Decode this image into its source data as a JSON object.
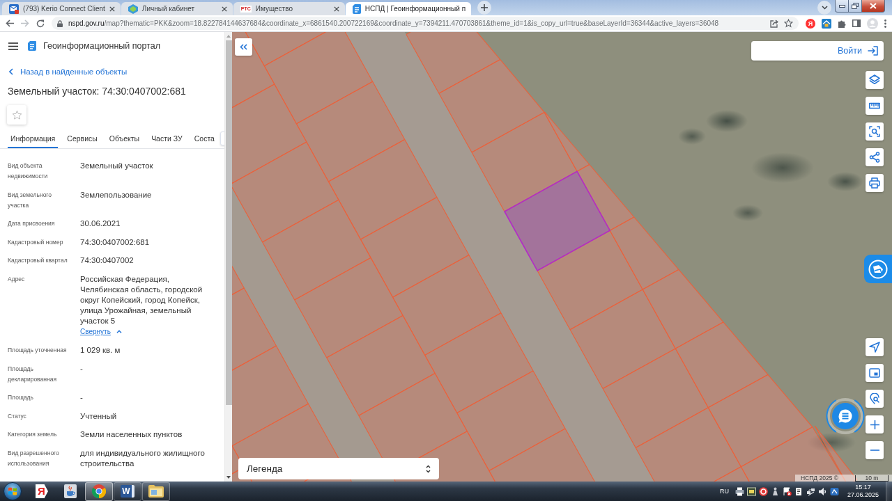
{
  "browser": {
    "tabs": [
      {
        "kind": "mail",
        "title": "(793) Kerio Connect Client",
        "selected": false
      },
      {
        "kind": "emblem",
        "title": "Личный кабинет",
        "selected": false
      },
      {
        "kind": "text",
        "favicon_text": "РТС",
        "title": "Имущество",
        "selected": false
      },
      {
        "kind": "portal",
        "title": "НСПД | Геоинформационный п",
        "selected": true
      }
    ],
    "back": {
      "disabled": false
    },
    "forward": {
      "disabled": true
    },
    "url": {
      "host": "nspd.gov.ru",
      "path": "/map?thematic=PKK&zoom=18.822784144637684&coordinate_x=6861540.200722169&coordinate_y=7394211.470703861&theme_id=1&is_copy_url=true&baseLayerId=36344&active_layers=36048"
    },
    "bookmarked": false,
    "extension_text": "Я"
  },
  "sidebar": {
    "portal_title": "Геоинформационный портал",
    "back_link": "Назад в найденные объекты",
    "title": "Земельный участок: 74:30:0407002:681",
    "favorite": false,
    "tabs": [
      {
        "label": "Информация",
        "selected": true
      },
      {
        "label": "Сервисы",
        "selected": false
      },
      {
        "label": "Объекты",
        "selected": false
      },
      {
        "label": "Части ЗУ",
        "selected": false
      },
      {
        "label": "Соста",
        "selected": false
      }
    ],
    "properties": [
      {
        "label": "Вид объекта недвижимости",
        "value": "Земельный участок"
      },
      {
        "label": "Вид земельного участка",
        "value": "Землепользование"
      },
      {
        "label": "Дата присвоения",
        "value": "30.06.2021"
      },
      {
        "label": "Кадастровый номер",
        "value": "74:30:0407002:681"
      },
      {
        "label": "Кадастровый квартал",
        "value": "74:30:0407002"
      },
      {
        "label": "Адрес",
        "value": "Российская Федерация, Челябинская область, городской округ Копейский, город Копейск, улица Урожайная, земельный участок 5",
        "toggle": {
          "label": "Свернуть",
          "expanded": true
        }
      },
      {
        "label": "Площадь уточненная",
        "value": "1 029 кв. м"
      },
      {
        "label": "Площадь декларированная",
        "value": "-"
      },
      {
        "label": "Площадь",
        "value": "-"
      },
      {
        "label": "Статус",
        "value": "Учтенный"
      },
      {
        "label": "Категория земель",
        "value": "Земли населенных пунктов"
      },
      {
        "label": "Вид разрешенного использования",
        "value": "для индивидуального жилищного строительства"
      }
    ]
  },
  "map": {
    "login_label": "Войти",
    "legend": "Легенда",
    "attribution": "НСПД 2025 ©",
    "scale": "10 m"
  },
  "taskbar": {
    "apps": [
      {
        "kind": "badge",
        "glyph": "Я",
        "running": false,
        "selected": false
      },
      {
        "kind": "cup",
        "running": false,
        "selected": false
      },
      {
        "kind": "wheel",
        "running": true,
        "selected": true
      },
      {
        "kind": "document",
        "glyph": "W",
        "running": true,
        "selected": false
      },
      {
        "kind": "folder",
        "running": true,
        "selected": false
      }
    ],
    "language": "RU",
    "time": "15:17",
    "date": "27.06.2025"
  }
}
